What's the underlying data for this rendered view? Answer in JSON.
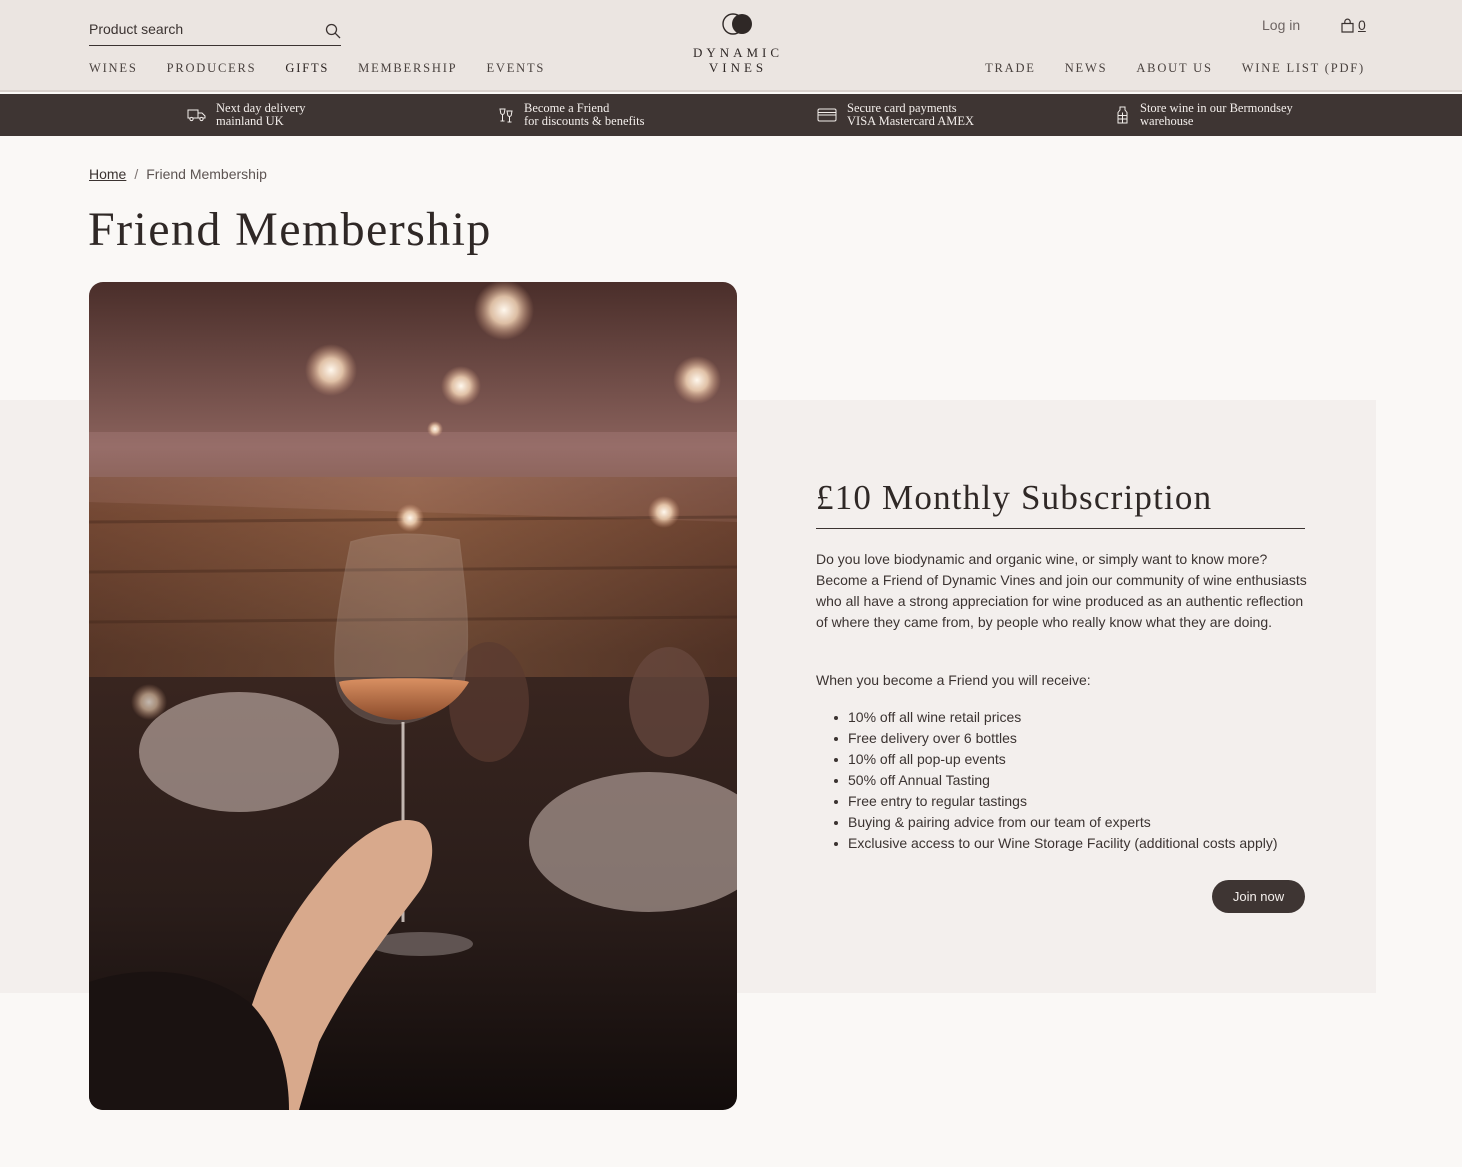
{
  "header": {
    "search": {
      "placeholder": "Product search",
      "icon": "search-icon"
    },
    "logo": {
      "line1": "DYNAMIC",
      "line2": "VINES"
    },
    "nav_left": [
      "WINES",
      "PRODUCERS",
      "GIFTS",
      "MEMBERSHIP",
      "EVENTS"
    ],
    "nav_right": [
      "TRADE",
      "NEWS",
      "ABOUT US",
      "WINE LIST (PDF)"
    ],
    "login_label": "Log in",
    "cart_count": "0"
  },
  "perks": [
    {
      "icon": "delivery-van-icon",
      "line1": "Next day delivery",
      "line2": "mainland UK"
    },
    {
      "icon": "wine-glasses-icon",
      "line1": "Become a Friend",
      "line2": "for discounts & benefits"
    },
    {
      "icon": "credit-card-icon",
      "line1": "Secure card payments",
      "line2": "VISA Mastercard AMEX"
    },
    {
      "icon": "wine-storage-icon",
      "line1": "Store wine in our  Bermondsey",
      "line2": "warehouse"
    }
  ],
  "breadcrumb": {
    "home": "Home",
    "separator": "/",
    "current": "Friend Membership"
  },
  "page_title": "Friend Membership",
  "subscription": {
    "title": "£10 Monthly Subscription",
    "intro": "Do you love biodynamic and organic wine, or simply want to know more? Become a Friend of Dynamic Vines and join our community of wine enthusiasts who all have a strong appreciation for wine produced as an authentic reflection of where they came from, by people who really know what they are doing.",
    "lead": "When you become a Friend you will receive:",
    "benefits": [
      "10% off all wine retail prices",
      "Free delivery over 6 bottles",
      "10% off all pop-up events",
      "50% off Annual Tasting",
      "Free entry to regular tastings",
      "Buying & pairing advice from our team of experts",
      "Exclusive access to our Wine Storage Facility (additional costs apply)"
    ],
    "cta": "Join now"
  },
  "colors": {
    "header_bg": "#ebe5e1",
    "perks_bg": "#3e3533",
    "page_bg": "#faf8f6",
    "panel_bg": "#f3efed",
    "text": "#3b3331",
    "button_bg": "#3e3533"
  }
}
